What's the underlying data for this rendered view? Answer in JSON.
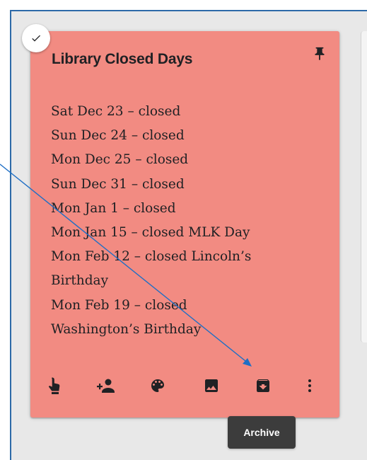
{
  "note": {
    "title": "Library Closed Days",
    "lines": [
      "Sat Dec 23 – closed",
      "Sun Dec 24 – closed",
      "Mon Dec 25 – closed",
      "Sun Dec 31 – closed",
      "Mon Jan 1 – closed",
      "Mon Jan 15 – closed MLK Day",
      "Mon Feb 12 – closed Lincoln’s",
      "Birthday",
      "Mon Feb 19 – closed",
      "Washington’s Birthday"
    ],
    "color": "#f28b82"
  },
  "toolbar": {
    "icons": [
      "remind-me-icon",
      "collaborator-icon",
      "palette-icon",
      "image-icon",
      "archive-icon",
      "more-icon"
    ]
  },
  "tooltip": {
    "text": "Archive"
  },
  "colors": {
    "annotation_arrow": "#1f6fc5",
    "tooltip_bg": "#3c3c3c",
    "icon": "#202124"
  }
}
